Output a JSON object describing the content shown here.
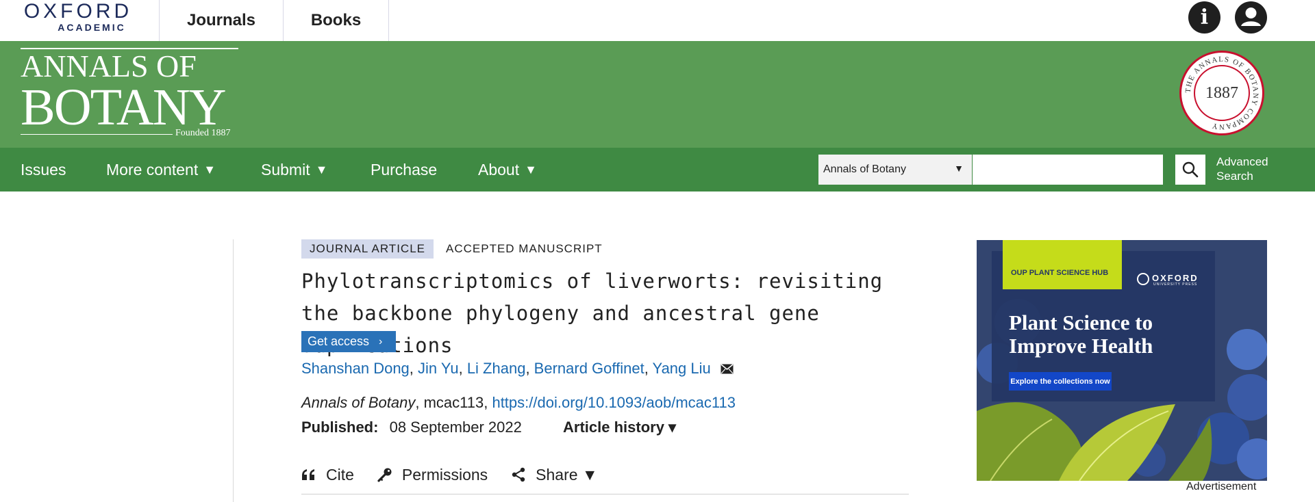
{
  "topbar": {
    "logo_main": "OXFORD",
    "logo_sub": "ACADEMIC",
    "nav": [
      "Journals",
      "Books"
    ],
    "icons": [
      "info-icon",
      "user-icon"
    ]
  },
  "banner": {
    "journal_line1": "ANNALS OF",
    "journal_line2": "BOTANY",
    "founded": "Founded 1887",
    "seal_year": "1887",
    "seal_text": "THE ANNALS OF BOTANY COMPANY"
  },
  "navbar": {
    "items": [
      {
        "label": "Issues",
        "has_caret": false
      },
      {
        "label": "More content",
        "has_caret": true
      },
      {
        "label": "Submit",
        "has_caret": true
      },
      {
        "label": "Purchase",
        "has_caret": false
      },
      {
        "label": "About",
        "has_caret": true
      }
    ],
    "caret": "▼",
    "search_scope": "Annals of Botany",
    "search_value": "",
    "advanced_search": "Advanced Search"
  },
  "article": {
    "type_tag": "JOURNAL ARTICLE",
    "status_tag": "ACCEPTED MANUSCRIPT",
    "title": "Phylotranscriptomics of liverworts: revisiting the backbone phylogeny and ancestral gene duplications",
    "get_access": "Get access",
    "authors": [
      "Shanshan Dong",
      "Jin Yu",
      "Li Zhang",
      "Bernard Goffinet",
      "Yang Liu"
    ],
    "journal": "Annals of Botany",
    "article_id": "mcac113",
    "doi": "https://doi.org/10.1093/aob/mcac113",
    "published_label": "Published:",
    "published_date": "08 September 2022",
    "history_label": "Article history ▾",
    "tools": [
      "Cite",
      "Permissions",
      "Share ▼"
    ]
  },
  "ad": {
    "hub_label": "OUP PLANT SCIENCE HUB",
    "publisher": "OXFORD",
    "publisher_sub": "UNIVERSITY PRESS",
    "headline": "Plant Science to Improve Health",
    "cta": "Explore the collections now",
    "label": "Advertisement"
  },
  "colors": {
    "banner_green": "#5a9c55",
    "nav_green": "#3f8a43",
    "link_blue": "#1a69b0",
    "button_blue": "#2a72b8",
    "tag_bg": "#d3d9ec"
  }
}
